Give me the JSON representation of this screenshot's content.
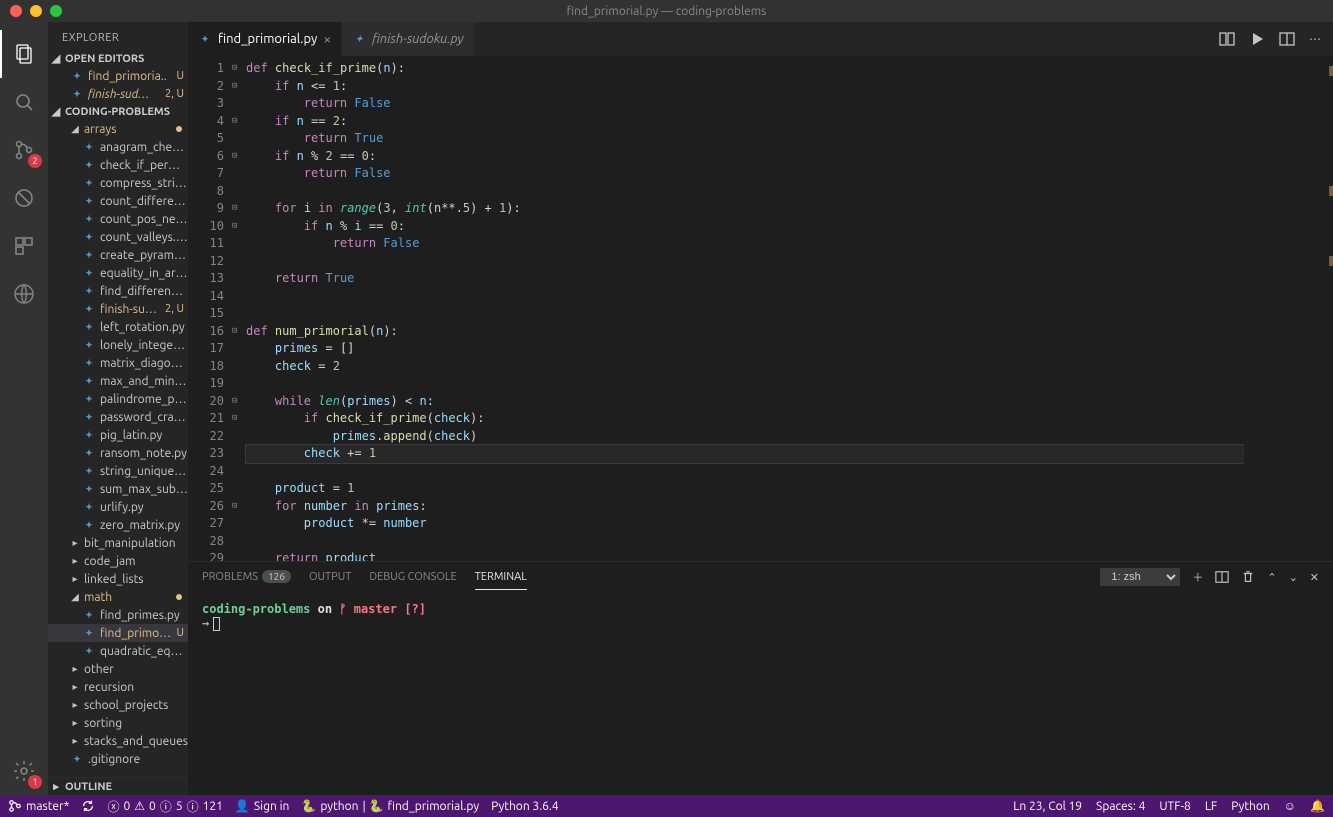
{
  "title": "find_primorial.py — coding-problems",
  "explorer_label": "EXPLORER",
  "sections": {
    "open_editors": "OPEN EDITORS",
    "project": "CODING-PROBLEMS",
    "outline": "OUTLINE"
  },
  "open_editors": [
    {
      "name": "find_primoria..",
      "badges": "U",
      "modified": true
    },
    {
      "name": "finish-sud…",
      "badges": "2, U",
      "modified": true,
      "italic": true
    }
  ],
  "tree": [
    {
      "type": "folder",
      "name": "arrays",
      "expanded": true,
      "modified": true,
      "dot": true
    },
    {
      "type": "file",
      "name": "anagram_check.py"
    },
    {
      "type": "file",
      "name": "check_if_permutat…"
    },
    {
      "type": "file",
      "name": "compress_string.py"
    },
    {
      "type": "file",
      "name": "count_differences…"
    },
    {
      "type": "file",
      "name": "count_pos_neg_ze…"
    },
    {
      "type": "file",
      "name": "count_valleys.py"
    },
    {
      "type": "file",
      "name": "create_pyramid.py"
    },
    {
      "type": "file",
      "name": "equality_in_array.py"
    },
    {
      "type": "file",
      "name": "find_difference.py"
    },
    {
      "type": "file",
      "name": "finish-sudo…",
      "badges": "2, U",
      "modified": true
    },
    {
      "type": "file",
      "name": "left_rotation.py"
    },
    {
      "type": "file",
      "name": "lonely_integer.py"
    },
    {
      "type": "file",
      "name": "matrix_diagonal_di…"
    },
    {
      "type": "file",
      "name": "max_and_min_sum…"
    },
    {
      "type": "file",
      "name": "palindrome_permu…"
    },
    {
      "type": "file",
      "name": "password_cracker…"
    },
    {
      "type": "file",
      "name": "pig_latin.py"
    },
    {
      "type": "file",
      "name": "ransom_note.py"
    },
    {
      "type": "file",
      "name": "string_unique_cha…"
    },
    {
      "type": "file",
      "name": "sum_max_subarra…"
    },
    {
      "type": "file",
      "name": "urlify.py"
    },
    {
      "type": "file",
      "name": "zero_matrix.py"
    },
    {
      "type": "folder",
      "name": "bit_manipulation",
      "expanded": false
    },
    {
      "type": "folder",
      "name": "code_jam",
      "expanded": false
    },
    {
      "type": "folder",
      "name": "linked_lists",
      "expanded": false
    },
    {
      "type": "folder",
      "name": "math",
      "expanded": true,
      "modified": true,
      "dot": true
    },
    {
      "type": "file",
      "name": "find_primes.py"
    },
    {
      "type": "file",
      "name": "find_primorial.…",
      "badges": "U",
      "modified": true,
      "selected": true
    },
    {
      "type": "file",
      "name": "quadratic_equatio…"
    },
    {
      "type": "folder",
      "name": "other",
      "expanded": false
    },
    {
      "type": "folder",
      "name": "recursion",
      "expanded": false
    },
    {
      "type": "folder",
      "name": "school_projects",
      "expanded": false
    },
    {
      "type": "folder",
      "name": "sorting",
      "expanded": false
    },
    {
      "type": "folder",
      "name": "stacks_and_queues",
      "expanded": false
    },
    {
      "type": "file",
      "name": ".gitignore",
      "toplevel": true
    }
  ],
  "tabs": [
    {
      "name": "find_primorial.py",
      "active": true,
      "closeable": true
    },
    {
      "name": "finish-sudoku.py",
      "active": false,
      "italic": true
    }
  ],
  "code_lines": [
    "def check_if_prime(n):",
    "    if n <= 1:",
    "        return False",
    "    if n == 2:",
    "        return True",
    "    if n % 2 == 0:",
    "        return False",
    "",
    "    for i in range(3, int(n**.5) + 1):",
    "        if n % i == 0:",
    "            return False",
    "",
    "    return True",
    "",
    "",
    "def num_primorial(n):",
    "    primes = []",
    "    check = 2",
    "",
    "    while len(primes) < n:",
    "        if check_if_prime(check):",
    "            primes.append(check)",
    "        check += 1",
    "",
    "    product = 1",
    "    for number in primes:",
    "        product *= number",
    "",
    "    return product"
  ],
  "fold_markers": {
    "1": "⊟",
    "2": "⊟",
    "4": "⊟",
    "6": "⊟",
    "9": "⊟",
    "10": "⊟",
    "16": "⊟",
    "20": "⊟",
    "21": "⊟",
    "26": "⊟"
  },
  "current_line": 23,
  "panel": {
    "tabs": {
      "problems": "PROBLEMS",
      "problems_count": "126",
      "output": "OUTPUT",
      "debug": "DEBUG CONSOLE",
      "terminal": "TERMINAL"
    },
    "terminal_select": "1: zsh",
    "prompt_dir": "coding-problems",
    "prompt_on": " on ",
    "prompt_branch": "master",
    "prompt_status": "[?]",
    "prompt_arrow": "→"
  },
  "activity_badges": {
    "scm": "2",
    "settings": "1"
  },
  "statusbar": {
    "branch": "master*",
    "sync": "",
    "errors": "0",
    "warnings": "0",
    "info_a": "5",
    "info_b": "121",
    "signin": "Sign in",
    "env": "python",
    "file": "find_primorial.py",
    "python": "Python 3.6.4",
    "cursor": "Ln 23, Col 19",
    "spaces": "Spaces: 4",
    "encoding": "UTF-8",
    "eol": "LF",
    "lang": "Python"
  }
}
